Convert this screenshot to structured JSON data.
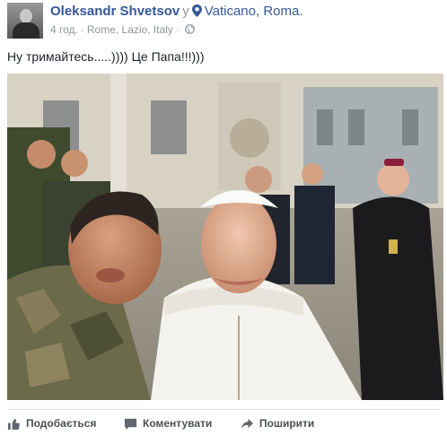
{
  "post": {
    "author": "Oleksandr Shvetsov",
    "location_connector": "у",
    "location_name": "Vaticano, Roma.",
    "time": "4 год.",
    "place_detail": "Rome, Lazio, Italy",
    "separator": "·",
    "text": "Ну тримайтесь.....)))) Це Папа!!!)))"
  },
  "icons": {
    "location": "location-pin-icon",
    "privacy": "globe-icon",
    "like": "thumbs-up-icon",
    "comment": "comment-bubble-icon",
    "share": "share-arrow-icon"
  },
  "actions": {
    "like_label": "Подобається",
    "comment_label": "Коментувати",
    "share_label": "Поширити"
  },
  "colors": {
    "link": "#365899",
    "meta": "#90949c",
    "action_text": "#4b4f56"
  }
}
